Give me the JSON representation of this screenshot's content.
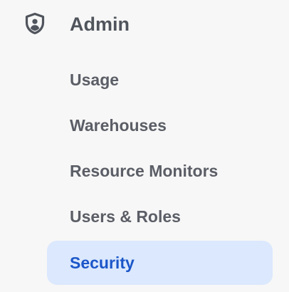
{
  "section": {
    "title": "Admin",
    "icon": "shield-user-icon"
  },
  "items": [
    {
      "label": "Usage",
      "active": false
    },
    {
      "label": "Warehouses",
      "active": false
    },
    {
      "label": "Resource Monitors",
      "active": false
    },
    {
      "label": "Users & Roles",
      "active": false
    },
    {
      "label": "Security",
      "active": true
    }
  ],
  "colors": {
    "background": "#f7f7f7",
    "text": "#5b5e66",
    "active_background": "#dbe8fd",
    "active_text": "#1b56c9"
  }
}
